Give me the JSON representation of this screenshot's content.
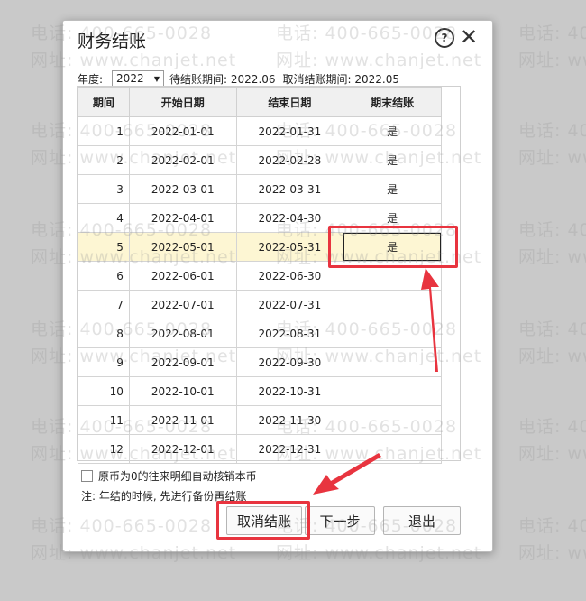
{
  "dialog": {
    "title": "财务结账",
    "help_symbol": "?",
    "close_symbol": "✕"
  },
  "filter": {
    "year_label": "年度:",
    "year_value": "2022",
    "pending_label": "待结账期间: 2022.06",
    "cancel_label": "取消结账期间: 2022.05"
  },
  "table": {
    "headers": [
      "期间",
      "开始日期",
      "结束日期",
      "期末结账"
    ],
    "rows": [
      {
        "period": "1",
        "start": "2022-01-01",
        "end": "2022-01-31",
        "closed": "是"
      },
      {
        "period": "2",
        "start": "2022-02-01",
        "end": "2022-02-28",
        "closed": "是"
      },
      {
        "period": "3",
        "start": "2022-03-01",
        "end": "2022-03-31",
        "closed": "是"
      },
      {
        "period": "4",
        "start": "2022-04-01",
        "end": "2022-04-30",
        "closed": "是"
      },
      {
        "period": "5",
        "start": "2022-05-01",
        "end": "2022-05-31",
        "closed": "是"
      },
      {
        "period": "6",
        "start": "2022-06-01",
        "end": "2022-06-30",
        "closed": ""
      },
      {
        "period": "7",
        "start": "2022-07-01",
        "end": "2022-07-31",
        "closed": ""
      },
      {
        "period": "8",
        "start": "2022-08-01",
        "end": "2022-08-31",
        "closed": ""
      },
      {
        "period": "9",
        "start": "2022-09-01",
        "end": "2022-09-30",
        "closed": ""
      },
      {
        "period": "10",
        "start": "2022-10-01",
        "end": "2022-10-31",
        "closed": ""
      },
      {
        "period": "11",
        "start": "2022-11-01",
        "end": "2022-11-30",
        "closed": ""
      },
      {
        "period": "12",
        "start": "2022-12-01",
        "end": "2022-12-31",
        "closed": ""
      }
    ]
  },
  "options": {
    "auto_writeoff_label": "原币为0的往来明细自动核销本币",
    "note": "注: 年结的时候, 先进行备份再结账"
  },
  "buttons": {
    "cancel_close": "取消结账",
    "next": "下一步",
    "exit": "退出"
  },
  "watermark": {
    "phone": "电话: 400-665-0028",
    "site": "网址: www.chanjet.net"
  },
  "colors": {
    "annotation": "#e8343f",
    "selected_row": "#fdf6d3"
  }
}
